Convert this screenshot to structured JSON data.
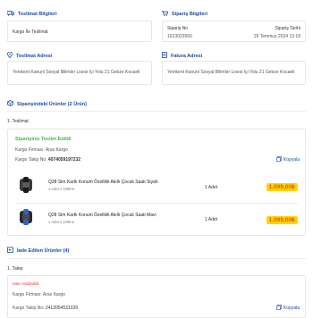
{
  "delivery_info": {
    "title": "Teslimat Bilgileri",
    "method": "Kargo İle Teslimat"
  },
  "order_info": {
    "title": "Sipariş Bilgileri",
    "number_label": "Sipariş No",
    "number_value": "1623023550",
    "date_label": "Sipariş Tarihi",
    "date_value": "29 Temmuz 2024 13:18"
  },
  "delivery_address": {
    "title": "Teslimat Adresi",
    "text": "Yenikent Kanuni Sosyal Bilimler Lisesi İçi Yolu 21 Gebze Kocaeli"
  },
  "invoice_address": {
    "title": "Fatura Adresi",
    "text": "Yenikent Kanuni Sosyal Bilimler Lisesi İçi Yolu 21 Gebze Kocaeli"
  },
  "order_products": {
    "title": "Siparişindeki Ürünler (2 Ürün)",
    "group_label": "1. Teslimat",
    "status": "Siparişiniz Teslim Edildi",
    "carrier_label": "Kargo Firması:",
    "carrier_value": "Aras Kargo",
    "tracking_label": "Kargo Takip No:",
    "tracking_value": "4074059197232",
    "copy_label": "Kopyala",
    "items": [
      {
        "name": "Q28 Sim Kartlı Konum Özellikli Akıllı Çocuk Saati Siyah",
        "sub": "1 Adet x 1099 ₺",
        "qty": "1 Adet",
        "price": "1.099,00₺",
        "band_color": "#1a1a1a",
        "face_color": "#3a3a3a"
      },
      {
        "name": "Q28 Sim Kartlı Konum Özellikli Akıllı Çocuk Saati Mavi",
        "sub": "1 Adet x 1099 ₺",
        "qty": "1 Adet",
        "price": "1.099,00₺",
        "band_color": "#2b63c6",
        "face_color": "#2a2a2a"
      }
    ]
  },
  "returns": {
    "title": "İade Edilen Ürünler (4)",
    "group_label": "1. Talep",
    "status": "İade reddedildi",
    "carrier_label": "Kargo Firması:",
    "carrier_value": "Aras Kargo",
    "tracking_label": "Kargo Takip No:",
    "tracking_value": "2412054531339",
    "copy_label": "Kopyala"
  }
}
